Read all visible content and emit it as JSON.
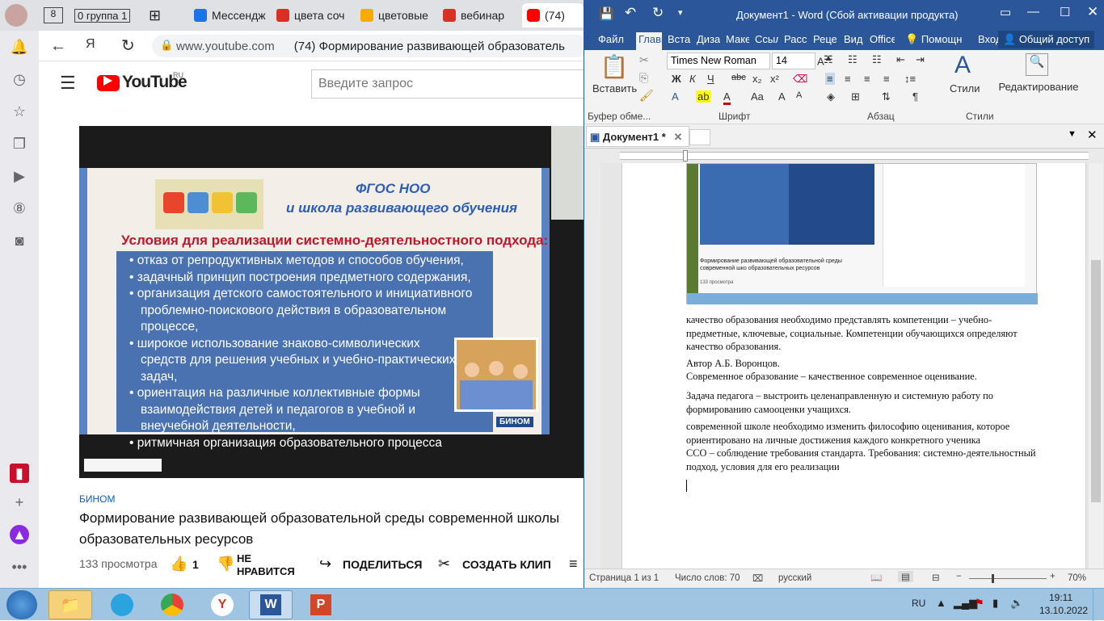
{
  "browser": {
    "tabs": [
      {
        "label": "8",
        "color": "#555"
      },
      {
        "label": "0 группа 1",
        "color": "#555"
      },
      {
        "label": "Мессендж",
        "color": "#1a73e8"
      },
      {
        "label": "цвета соч",
        "color": "#d93025"
      },
      {
        "label": "цветовые",
        "color": "#f9ab00"
      },
      {
        "label": "вебинар",
        "color": "#d93025"
      },
      {
        "label": "(74)",
        "color": "#ff0000"
      }
    ],
    "url": "www.youtube.com",
    "page_title": "(74) Формирование развивающей образователь"
  },
  "youtube": {
    "logo": "YouTube",
    "region": "RU",
    "search_placeholder": "Введите запрос",
    "slide": {
      "title1": "ФГОС НОО",
      "title2": "и школа развивающего обучения",
      "heading": "Условия для реализации системно-деятельностного подхода:",
      "bullets": [
        "отказ от репродуктивных методов и способов обучения,",
        "задачный принцип построения предметного содержания,",
        "организация детского самостоятельного и инициативного проблемно-поискового действия в образовательном процессе,",
        "широкое использование знаково-символических средств для решения учебных и учебно-практических задач,",
        "ориентация на различные коллективные формы взаимодействия детей и педагогов в учебной и внеучебной деятельности,",
        "ритмичная организация образовательного процесса"
      ],
      "brand": "БИНОМ"
    },
    "channel": "БИНОМ",
    "video_title": "Формирование развивающей образовательной среды современной школы образовательных ресурсов",
    "views": "133 просмотра",
    "likes": "1",
    "dislike": "НЕ НРАВИТСЯ",
    "share": "ПОДЕЛИТЬСЯ",
    "clip": "СОЗДАТЬ КЛИП"
  },
  "word": {
    "title": "Документ1 - Word (Сбой активации продукта)",
    "tabs": [
      "Файл",
      "Главн",
      "Вста",
      "Диза",
      "Маке",
      "Ссыл",
      "Расс",
      "Реце",
      "Вид",
      "Office",
      "Помощн",
      "Вход",
      "Общий доступ"
    ],
    "font_name": "Times New Roman",
    "font_size": "14",
    "paste_label": "Вставить",
    "styles_label": "Стили",
    "editing_label": "Редактирование",
    "groups": [
      "Буфер обме...",
      "Шрифт",
      "Абзац",
      "Стили"
    ],
    "doc_tab": "Документ1 *",
    "paragraphs": [
      " качество образования необходимо представлять компетенции – учебно-предметные, ключевые, социальные. Компетенции обучающихся определяют качество образования.",
      "Автор А.Б. Воронцов.",
      "Современное образование – качественное современное оценивание.",
      "Задача педагога – выстроить целенаправленную и системную работу по формированию самооценки учащихся.",
      "современной школе необходимо изменить философию оценивания, которое ориентировано на личные достижения каждого конкретного ученика",
      "ССО – соблюдение требования стандарта. Требования: системно-деятельностный подход, условия для его реализации"
    ],
    "embedded_caption": "Формирование развивающей образовательной среды современной шко образовательных ресурсов",
    "embedded_views": "133 просмотра",
    "status": {
      "page": "Страница 1 из 1",
      "words": "Число слов: 70",
      "lang": "русский",
      "zoom": "70%"
    }
  },
  "taskbar": {
    "lang": "RU",
    "time": "19:11",
    "date": "13.10.2022"
  }
}
